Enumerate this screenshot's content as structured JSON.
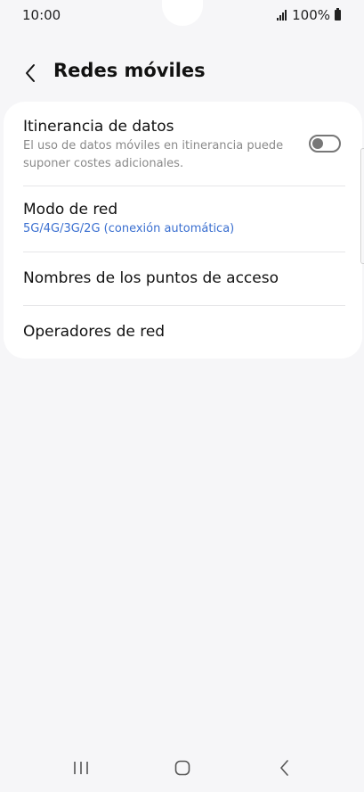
{
  "status_bar": {
    "time": "10:00",
    "battery_text": "100%"
  },
  "header": {
    "title": "Redes móviles",
    "back_icon": "chevron-left-icon"
  },
  "settings": {
    "roaming": {
      "title": "Itinerancia de datos",
      "description": "El uso de datos móviles en itinerancia puede suponer costes adicionales.",
      "enabled": false
    },
    "network_mode": {
      "title": "Modo de red",
      "value": "5G/4G/3G/2G (conexión automática)"
    },
    "apn": {
      "title": "Nombres de los puntos de acceso"
    },
    "operators": {
      "title": "Operadores de red"
    }
  },
  "nav": {
    "recents_icon": "recents-icon",
    "home_icon": "home-icon",
    "back_icon": "back-icon"
  },
  "colors": {
    "background": "#f6f6f8",
    "card": "#ffffff",
    "accent": "#3a6fd0",
    "secondary_text": "#8a8a8a"
  }
}
